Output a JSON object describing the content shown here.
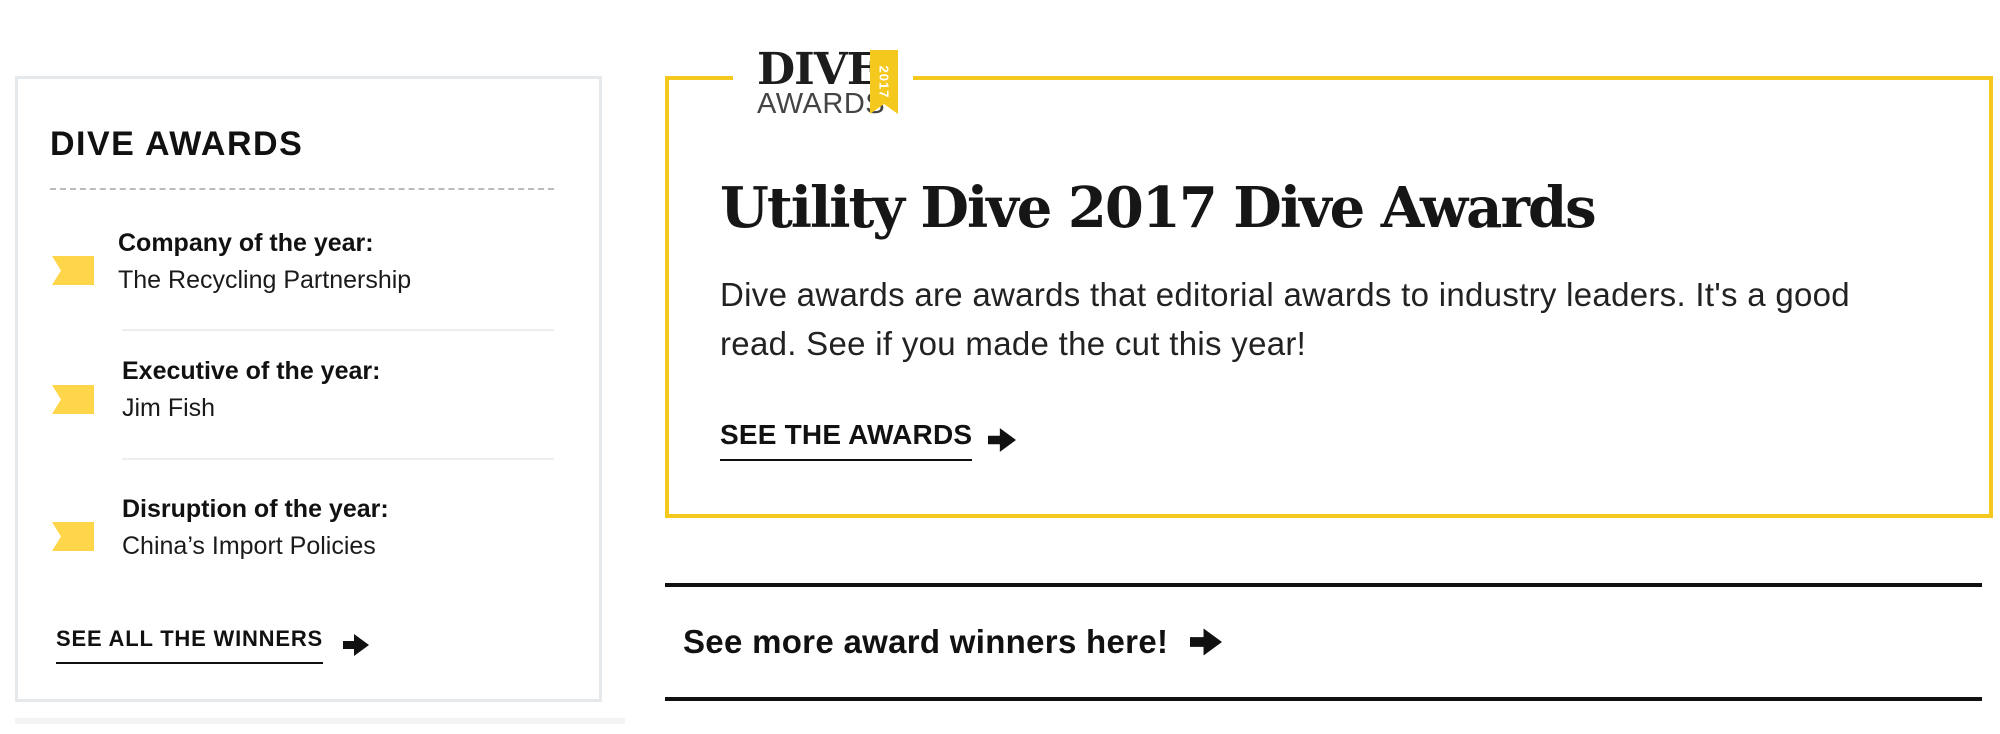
{
  "sidebar": {
    "title": "DIVE AWARDS",
    "items": [
      {
        "label": "Company of the year:",
        "value": "The Recycling Partnership",
        "icon": "ribbon-icon"
      },
      {
        "label": "Executive of the year:",
        "value": "Jim Fish",
        "icon": "ribbon-icon"
      },
      {
        "label": "Disruption of the year:",
        "value": "China’s Import Policies",
        "icon": "ribbon-icon"
      }
    ],
    "see_all_label": "SEE ALL THE WINNERS",
    "see_all_icon": "arrow-right-icon"
  },
  "feature": {
    "logo": {
      "word1": "DIVE",
      "word2": "AWARDS",
      "year": "2017"
    },
    "title": "Utility Dive 2017 Dive Awards",
    "description": "Dive awards are awards that editorial awards to industry leaders. It's a good read. See if you made the cut this year!",
    "cta_label": "SEE THE AWARDS",
    "cta_icon": "arrow-right-icon"
  },
  "more": {
    "label": "See more award winners here!",
    "icon": "arrow-right-icon"
  },
  "colors": {
    "accent": "#f5c81e",
    "ribbon": "#ffd54a",
    "text": "#111111",
    "panel_border": "#e6e9ec"
  }
}
